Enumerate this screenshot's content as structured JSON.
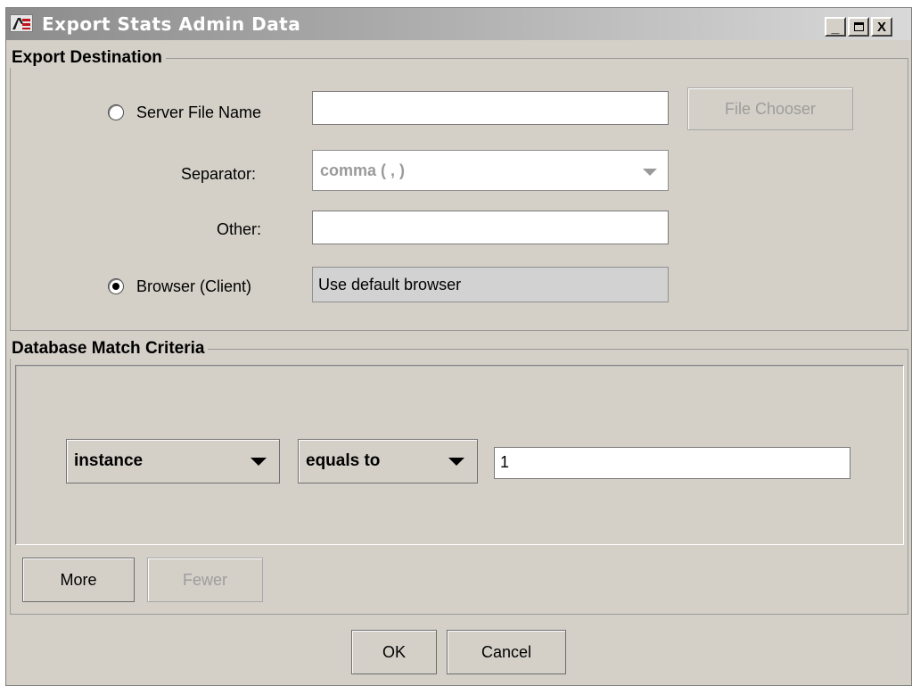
{
  "window": {
    "title": "Export Stats Admin Data",
    "controls": {
      "minimize": "_",
      "maximize": "□",
      "close": "X"
    }
  },
  "export_destination": {
    "title": "Export Destination",
    "server_file": {
      "label": "Server File Name",
      "selected": false,
      "value": "",
      "chooser_button": "File Chooser"
    },
    "separator": {
      "label": "Separator:",
      "value": "comma ( , )"
    },
    "other": {
      "label": "Other:",
      "value": ""
    },
    "browser": {
      "label": "Browser (Client)",
      "selected": true,
      "value": "Use default browser"
    }
  },
  "match_criteria": {
    "title": "Database Match Criteria",
    "field": "instance",
    "operator": "equals to",
    "value": "1",
    "more_button": "More",
    "fewer_button": "Fewer"
  },
  "footer": {
    "ok": "OK",
    "cancel": "Cancel"
  }
}
